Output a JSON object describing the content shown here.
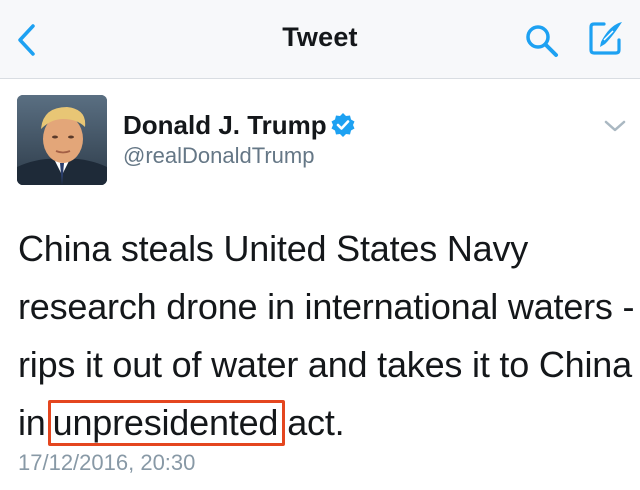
{
  "nav": {
    "title": "Tweet",
    "back_icon": "chevron-left-icon",
    "search_icon": "search-icon",
    "compose_icon": "compose-icon"
  },
  "author": {
    "display_name": "Donald J. Trump",
    "handle": "@realDonaldTrump",
    "verified": true,
    "avatar": "profile-photo"
  },
  "tweet": {
    "line1": "China steals United States Navy",
    "line2": "research drone in international waters -",
    "line3": "rips it out of water and takes it to China",
    "line4_before": "in",
    "line4_highlight": "unpresidented",
    "line4_after": "act.",
    "timestamp": "17/12/2016, 20:30"
  },
  "colors": {
    "accent": "#1da1f2",
    "highlight_box": "#e4461f",
    "muted": "#657786"
  }
}
